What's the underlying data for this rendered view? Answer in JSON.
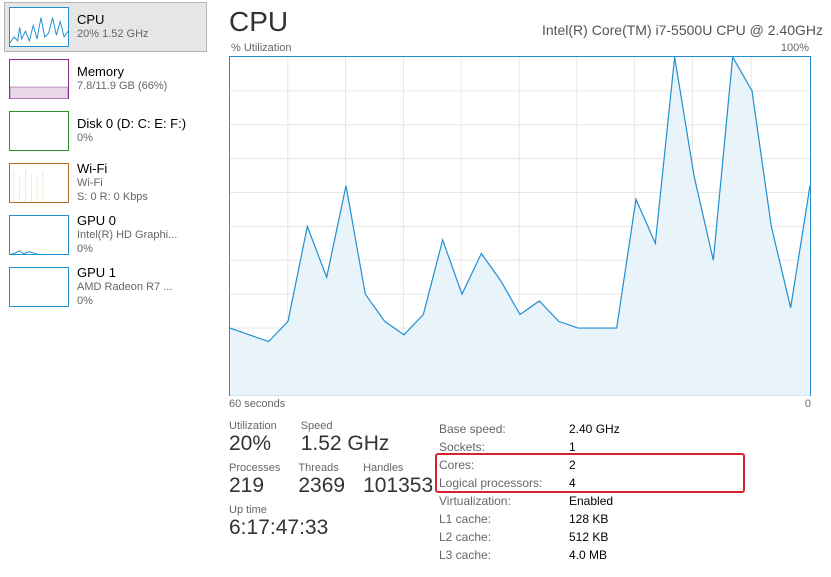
{
  "sidebar": {
    "items": [
      {
        "title": "CPU",
        "sub1": "20% 1.52 GHz",
        "sub2": "",
        "color": "#208fd1",
        "selected": true
      },
      {
        "title": "Memory",
        "sub1": "7.8/11.9 GB (66%)",
        "sub2": "",
        "color": "#8e2f8e"
      },
      {
        "title": "Disk 0 (D: C: E: F:)",
        "sub1": "0%",
        "sub2": "",
        "color": "#2f8e2f"
      },
      {
        "title": "Wi-Fi",
        "sub1": "Wi-Fi",
        "sub2": "S: 0 R: 0 Kbps",
        "color": "#b36b1f"
      },
      {
        "title": "GPU 0",
        "sub1": "Intel(R) HD Graphi...",
        "sub2": "0%",
        "color": "#208fd1"
      },
      {
        "title": "GPU 1",
        "sub1": "AMD Radeon R7 ...",
        "sub2": "0%",
        "color": "#208fd1"
      }
    ]
  },
  "header": {
    "title": "CPU",
    "subtitle": "Intel(R) Core(TM) i7-5500U CPU @ 2.40GHz"
  },
  "axis": {
    "top_left": "% Utilization",
    "top_right": "100%",
    "bottom_left": "60 seconds",
    "bottom_right": "0"
  },
  "chart_data": {
    "type": "line",
    "title": "% Utilization",
    "xlabel": "seconds",
    "ylabel": "% Utilization",
    "ylim": [
      0,
      100
    ],
    "x": [
      60,
      58,
      56,
      54,
      52,
      50,
      48,
      46,
      44,
      42,
      40,
      38,
      36,
      34,
      32,
      30,
      28,
      26,
      24,
      22,
      20,
      18,
      16,
      14,
      12,
      10,
      8,
      6,
      4,
      2,
      0
    ],
    "values": [
      20,
      18,
      16,
      22,
      50,
      35,
      62,
      30,
      22,
      18,
      24,
      46,
      30,
      42,
      34,
      24,
      28,
      22,
      20,
      20,
      20,
      58,
      45,
      100,
      65,
      40,
      100,
      90,
      50,
      26,
      62
    ]
  },
  "stats_left": {
    "utilization_label": "Utilization",
    "utilization_value": "20%",
    "speed_label": "Speed",
    "speed_value": "1.52 GHz",
    "processes_label": "Processes",
    "processes_value": "219",
    "threads_label": "Threads",
    "threads_value": "2369",
    "handles_label": "Handles",
    "handles_value": "101353",
    "uptime_label": "Up time",
    "uptime_value": "6:17:47:33"
  },
  "specs": [
    {
      "label": "Base speed:",
      "value": "2.40 GHz"
    },
    {
      "label": "Sockets:",
      "value": "1"
    },
    {
      "label": "Cores:",
      "value": "2"
    },
    {
      "label": "Logical processors:",
      "value": "4"
    },
    {
      "label": "Virtualization:",
      "value": "Enabled"
    },
    {
      "label": "L1 cache:",
      "value": "128 KB"
    },
    {
      "label": "L2 cache:",
      "value": "512 KB"
    },
    {
      "label": "L3 cache:",
      "value": "4.0 MB"
    }
  ]
}
